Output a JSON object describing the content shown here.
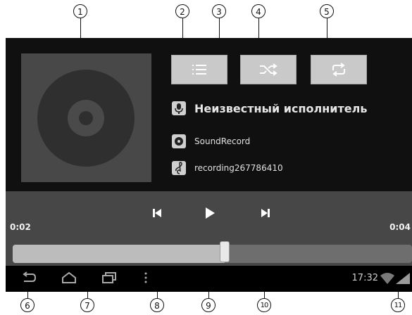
{
  "callouts": [
    "1",
    "2",
    "3",
    "4",
    "5",
    "6",
    "7",
    "8",
    "9",
    "10",
    "11"
  ],
  "track": {
    "artist": "Неизвестный исполнитель",
    "album": "SoundRecord",
    "title": "recording267786410"
  },
  "playback": {
    "elapsed": "0:02",
    "duration": "0:04",
    "progress_fraction": 0.53
  },
  "status_bar": {
    "clock": "17:32"
  },
  "icons": {
    "playlist": "playlist-icon",
    "shuffle": "shuffle-icon",
    "repeat": "repeat-icon",
    "previous": "previous-track-icon",
    "play": "play-icon",
    "next": "next-track-icon"
  },
  "colors": {
    "screen_bg": "#101010",
    "button_bg": "#c9c9c9",
    "panel_bg": "#474747"
  }
}
